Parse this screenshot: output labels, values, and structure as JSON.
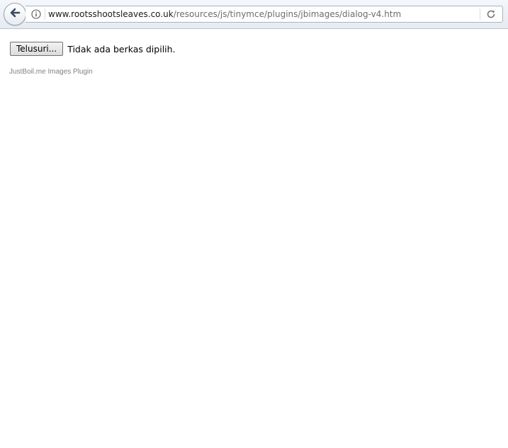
{
  "browser": {
    "url_domain": "www.rootsshootsleaves.co.uk",
    "url_path": "/resources/js/tinymce/plugins/jbimages/dialog-v4.htm",
    "icons": {
      "back": "back-arrow-icon",
      "info": "info-icon",
      "reload": "reload-icon"
    }
  },
  "upload": {
    "browse_label": "Telusuri...",
    "status_text": "Tidak ada berkas dipilih."
  },
  "footer": {
    "credit": "JustBoil.me Images Plugin"
  }
}
